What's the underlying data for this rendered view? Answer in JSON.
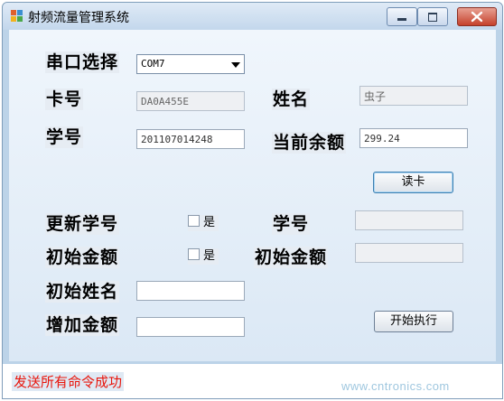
{
  "window": {
    "title": "射频流量管理系统"
  },
  "serial": {
    "label": "串口选择",
    "selected": "COM7"
  },
  "card": {
    "card_no_label": "卡号",
    "card_no_value": "DA0A455E",
    "name_label": "姓名",
    "name_value": "虫子",
    "student_id_label": "学号",
    "student_id_value": "201107014248",
    "balance_label": "当前余额",
    "balance_value": "299.24",
    "read_button": "读卡"
  },
  "update": {
    "update_id_label": "更新学号",
    "update_id_check": "是",
    "new_id_label": "学号",
    "new_id_value": "",
    "init_amount_label": "初始金额",
    "init_amount_check": "是",
    "init_amount_label2": "初始金额",
    "init_amount_value": "",
    "init_name_label": "初始姓名",
    "init_name_value": "",
    "add_amount_label": "增加金额",
    "add_amount_value": "",
    "execute_button": "开始执行"
  },
  "status": {
    "message": "发送所有命令成功",
    "color": "#e8160c"
  },
  "watermark": "www.cntronics.com"
}
